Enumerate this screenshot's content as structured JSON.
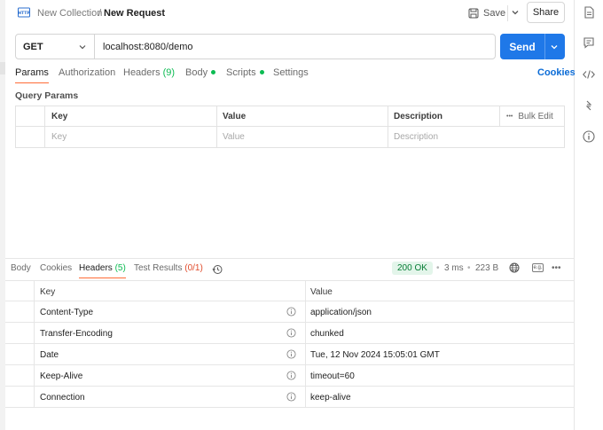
{
  "header": {
    "collection": "New Collection",
    "separator": "/",
    "request_name": "New Request",
    "save_label": "Save",
    "share_label": "Share"
  },
  "request": {
    "method": "GET",
    "url": "localhost:8080/demo",
    "send_label": "Send"
  },
  "request_tabs": {
    "params": "Params",
    "authorization": "Authorization",
    "headers": "Headers",
    "headers_count": "(9)",
    "body": "Body",
    "scripts": "Scripts",
    "settings": "Settings",
    "cookies": "Cookies"
  },
  "query_params": {
    "title": "Query Params",
    "columns": [
      "Key",
      "Value",
      "Description"
    ],
    "bulk_edit": "Bulk Edit",
    "more": "•••",
    "placeholders": {
      "key": "Key",
      "value": "Value",
      "description": "Description"
    }
  },
  "response": {
    "tabs": {
      "body": "Body",
      "cookies": "Cookies",
      "headers": "Headers",
      "headers_count": "(5)",
      "test_results": "Test Results",
      "test_count": "(0/1)"
    },
    "status": "200 OK",
    "time": "3 ms",
    "size": "223 B",
    "dot": "•",
    "more": "•••",
    "example_icon_text": "e.g.",
    "columns": {
      "key": "Key",
      "value": "Value"
    },
    "headers": [
      {
        "key": "Content-Type",
        "value": "application/json"
      },
      {
        "key": "Transfer-Encoding",
        "value": "chunked"
      },
      {
        "key": "Date",
        "value": "Tue, 12 Nov 2024 15:05:01 GMT"
      },
      {
        "key": "Keep-Alive",
        "value": "timeout=60"
      },
      {
        "key": "Connection",
        "value": "keep-alive"
      }
    ]
  },
  "colors": {
    "accent_orange": "#ff6c37",
    "send_blue": "#1f78e8",
    "link_blue": "#0b6bd6",
    "status_green": "#067d35",
    "dot_green": "#0cbb52"
  },
  "icons": {
    "right_bar": [
      "document-icon",
      "comment-icon",
      "code-icon",
      "related-icon",
      "info-icon"
    ]
  }
}
